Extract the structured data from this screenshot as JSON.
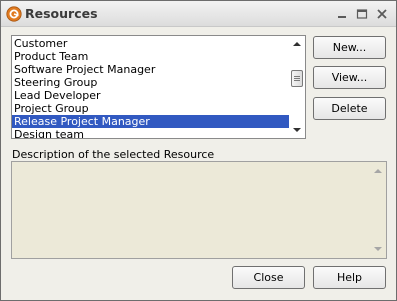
{
  "window": {
    "title": "Resources"
  },
  "resources": {
    "items": [
      "Customer",
      "Product Team",
      "Software Project Manager",
      "Steering Group",
      "Lead Developer",
      "Project Group",
      "Release Project Manager",
      "Design team"
    ],
    "selected_index": 6
  },
  "buttons": {
    "new": "New...",
    "view": "View...",
    "delete": "Delete",
    "close": "Close",
    "help": "Help"
  },
  "description": {
    "label": "Description of the selected Resource",
    "value": ""
  },
  "colors": {
    "selection": "#3159c1",
    "app_icon": "#e07a1f",
    "description_bg": "#ece9d8"
  },
  "icons": {
    "app": "app-logo-icon",
    "minimize": "minimize-icon",
    "maximize": "maximize-icon",
    "close": "close-icon"
  }
}
